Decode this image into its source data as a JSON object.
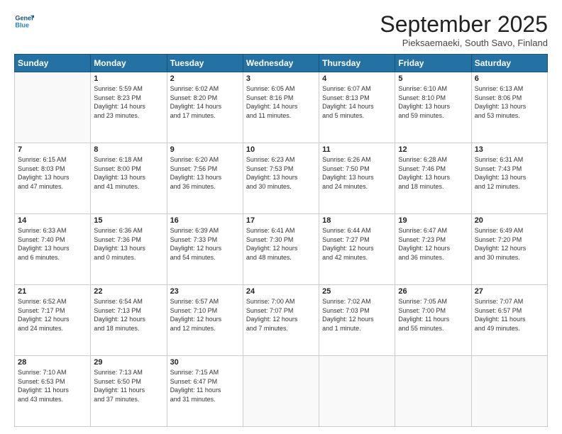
{
  "header": {
    "logo_line1": "General",
    "logo_line2": "Blue",
    "month": "September 2025",
    "location": "Pieksaemaeki, South Savo, Finland"
  },
  "days_of_week": [
    "Sunday",
    "Monday",
    "Tuesday",
    "Wednesday",
    "Thursday",
    "Friday",
    "Saturday"
  ],
  "weeks": [
    [
      {
        "day": "",
        "info": ""
      },
      {
        "day": "1",
        "info": "Sunrise: 5:59 AM\nSunset: 8:23 PM\nDaylight: 14 hours\nand 23 minutes."
      },
      {
        "day": "2",
        "info": "Sunrise: 6:02 AM\nSunset: 8:20 PM\nDaylight: 14 hours\nand 17 minutes."
      },
      {
        "day": "3",
        "info": "Sunrise: 6:05 AM\nSunset: 8:16 PM\nDaylight: 14 hours\nand 11 minutes."
      },
      {
        "day": "4",
        "info": "Sunrise: 6:07 AM\nSunset: 8:13 PM\nDaylight: 14 hours\nand 5 minutes."
      },
      {
        "day": "5",
        "info": "Sunrise: 6:10 AM\nSunset: 8:10 PM\nDaylight: 13 hours\nand 59 minutes."
      },
      {
        "day": "6",
        "info": "Sunrise: 6:13 AM\nSunset: 8:06 PM\nDaylight: 13 hours\nand 53 minutes."
      }
    ],
    [
      {
        "day": "7",
        "info": "Sunrise: 6:15 AM\nSunset: 8:03 PM\nDaylight: 13 hours\nand 47 minutes."
      },
      {
        "day": "8",
        "info": "Sunrise: 6:18 AM\nSunset: 8:00 PM\nDaylight: 13 hours\nand 41 minutes."
      },
      {
        "day": "9",
        "info": "Sunrise: 6:20 AM\nSunset: 7:56 PM\nDaylight: 13 hours\nand 36 minutes."
      },
      {
        "day": "10",
        "info": "Sunrise: 6:23 AM\nSunset: 7:53 PM\nDaylight: 13 hours\nand 30 minutes."
      },
      {
        "day": "11",
        "info": "Sunrise: 6:26 AM\nSunset: 7:50 PM\nDaylight: 13 hours\nand 24 minutes."
      },
      {
        "day": "12",
        "info": "Sunrise: 6:28 AM\nSunset: 7:46 PM\nDaylight: 13 hours\nand 18 minutes."
      },
      {
        "day": "13",
        "info": "Sunrise: 6:31 AM\nSunset: 7:43 PM\nDaylight: 13 hours\nand 12 minutes."
      }
    ],
    [
      {
        "day": "14",
        "info": "Sunrise: 6:33 AM\nSunset: 7:40 PM\nDaylight: 13 hours\nand 6 minutes."
      },
      {
        "day": "15",
        "info": "Sunrise: 6:36 AM\nSunset: 7:36 PM\nDaylight: 13 hours\nand 0 minutes."
      },
      {
        "day": "16",
        "info": "Sunrise: 6:39 AM\nSunset: 7:33 PM\nDaylight: 12 hours\nand 54 minutes."
      },
      {
        "day": "17",
        "info": "Sunrise: 6:41 AM\nSunset: 7:30 PM\nDaylight: 12 hours\nand 48 minutes."
      },
      {
        "day": "18",
        "info": "Sunrise: 6:44 AM\nSunset: 7:27 PM\nDaylight: 12 hours\nand 42 minutes."
      },
      {
        "day": "19",
        "info": "Sunrise: 6:47 AM\nSunset: 7:23 PM\nDaylight: 12 hours\nand 36 minutes."
      },
      {
        "day": "20",
        "info": "Sunrise: 6:49 AM\nSunset: 7:20 PM\nDaylight: 12 hours\nand 30 minutes."
      }
    ],
    [
      {
        "day": "21",
        "info": "Sunrise: 6:52 AM\nSunset: 7:17 PM\nDaylight: 12 hours\nand 24 minutes."
      },
      {
        "day": "22",
        "info": "Sunrise: 6:54 AM\nSunset: 7:13 PM\nDaylight: 12 hours\nand 18 minutes."
      },
      {
        "day": "23",
        "info": "Sunrise: 6:57 AM\nSunset: 7:10 PM\nDaylight: 12 hours\nand 12 minutes."
      },
      {
        "day": "24",
        "info": "Sunrise: 7:00 AM\nSunset: 7:07 PM\nDaylight: 12 hours\nand 7 minutes."
      },
      {
        "day": "25",
        "info": "Sunrise: 7:02 AM\nSunset: 7:03 PM\nDaylight: 12 hours\nand 1 minute."
      },
      {
        "day": "26",
        "info": "Sunrise: 7:05 AM\nSunset: 7:00 PM\nDaylight: 11 hours\nand 55 minutes."
      },
      {
        "day": "27",
        "info": "Sunrise: 7:07 AM\nSunset: 6:57 PM\nDaylight: 11 hours\nand 49 minutes."
      }
    ],
    [
      {
        "day": "28",
        "info": "Sunrise: 7:10 AM\nSunset: 6:53 PM\nDaylight: 11 hours\nand 43 minutes."
      },
      {
        "day": "29",
        "info": "Sunrise: 7:13 AM\nSunset: 6:50 PM\nDaylight: 11 hours\nand 37 minutes."
      },
      {
        "day": "30",
        "info": "Sunrise: 7:15 AM\nSunset: 6:47 PM\nDaylight: 11 hours\nand 31 minutes."
      },
      {
        "day": "",
        "info": ""
      },
      {
        "day": "",
        "info": ""
      },
      {
        "day": "",
        "info": ""
      },
      {
        "day": "",
        "info": ""
      }
    ]
  ]
}
